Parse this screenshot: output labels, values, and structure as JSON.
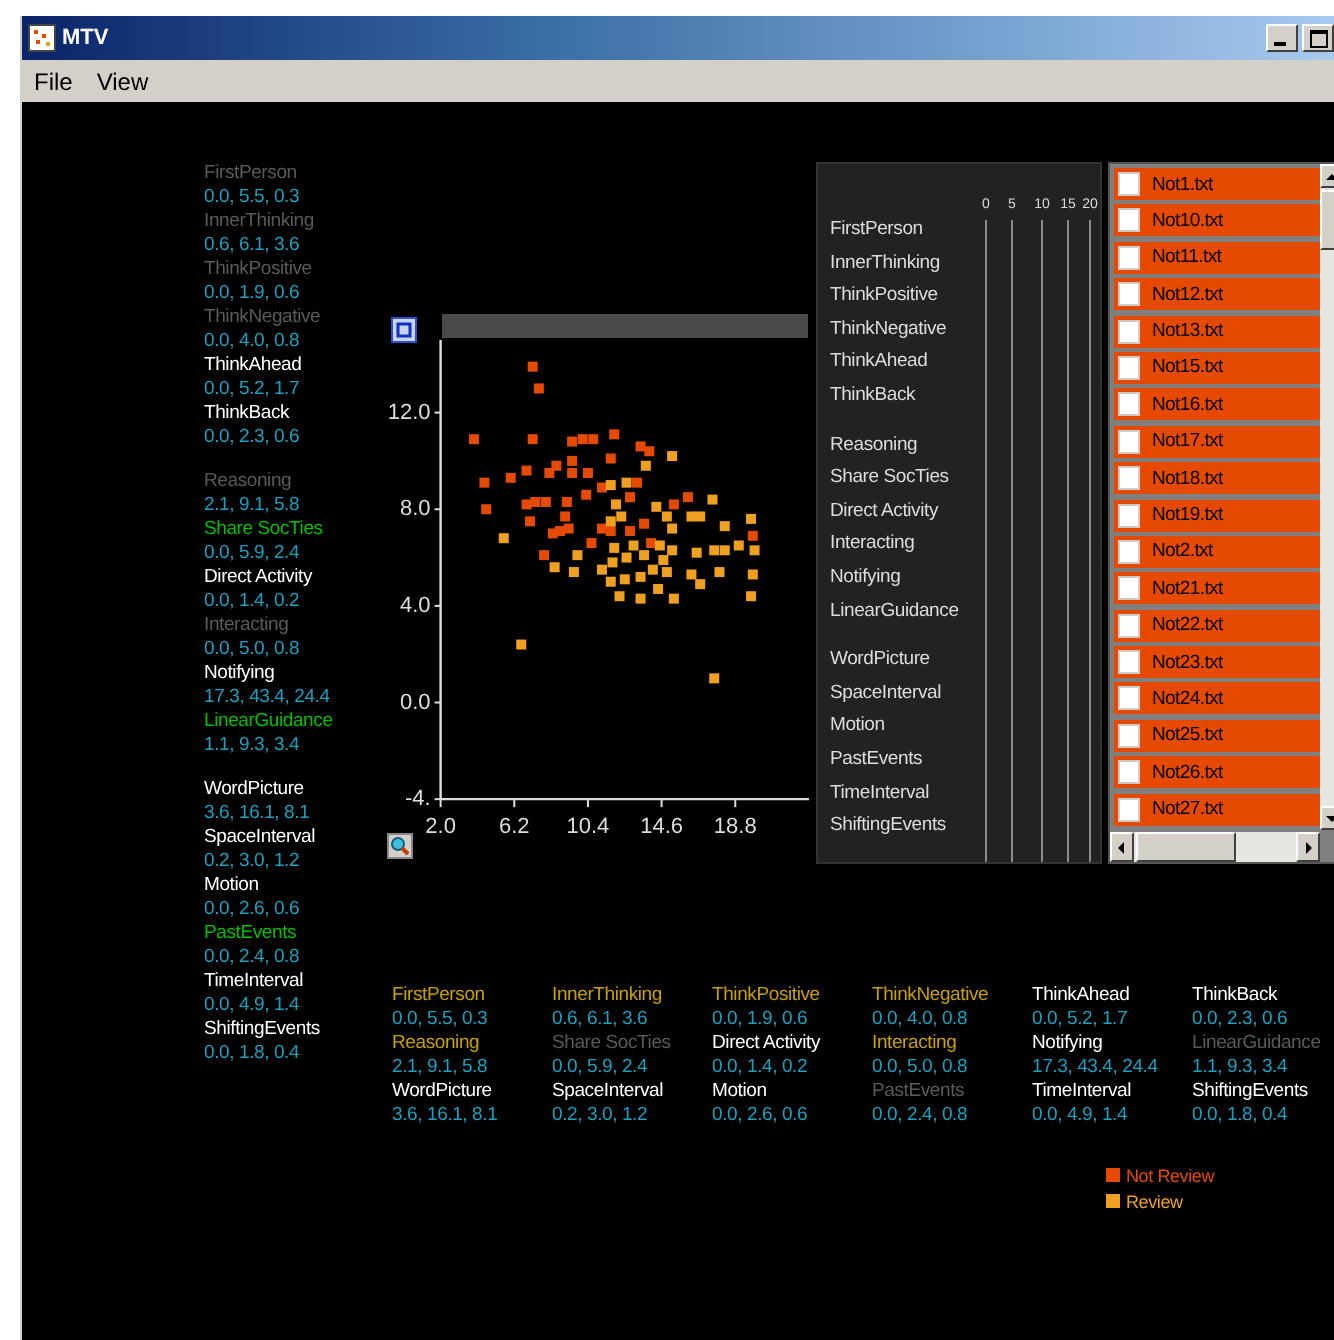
{
  "window": {
    "title": "MTV"
  },
  "menu": [
    "File",
    "View"
  ],
  "feature_groups": [
    {
      "features": [
        {
          "label": "FirstPerson",
          "values": "0.0, 5.5, 0.3",
          "color": "#5a5a5a"
        },
        {
          "label": "InnerThinking",
          "values": "0.6, 6.1, 3.6",
          "color": "#5a5a5a"
        },
        {
          "label": "ThinkPositive",
          "values": "0.0, 1.9, 0.6",
          "color": "#5a5a5a"
        },
        {
          "label": "ThinkNegative",
          "values": "0.0, 4.0, 0.8",
          "color": "#5a5a5a"
        },
        {
          "label": "ThinkAhead",
          "values": "0.0, 5.2, 1.7",
          "color": "#ffffff"
        },
        {
          "label": "ThinkBack",
          "values": "0.0, 2.3, 0.6",
          "color": "#ffffff"
        }
      ]
    },
    {
      "features": [
        {
          "label": "Reasoning",
          "values": "2.1, 9.1, 5.8",
          "color": "#5a5a5a"
        },
        {
          "label": "Share SocTies",
          "values": "0.0, 5.9, 2.4",
          "color": "#00c000"
        },
        {
          "label": "Direct Activity",
          "values": "0.0, 1.4, 0.2",
          "color": "#ffffff"
        },
        {
          "label": "Interacting",
          "values": "0.0, 5.0, 0.8",
          "color": "#5a5a5a"
        },
        {
          "label": "Notifying",
          "values": "17.3, 43.4, 24.4",
          "color": "#ffffff"
        },
        {
          "label": "LinearGuidance",
          "values": "1.1, 9.3, 3.4",
          "color": "#00c000"
        }
      ]
    },
    {
      "features": [
        {
          "label": "WordPicture",
          "values": "3.6, 16.1, 8.1",
          "color": "#ffffff"
        },
        {
          "label": "SpaceInterval",
          "values": "0.2, 3.0, 1.2",
          "color": "#ffffff"
        },
        {
          "label": "Motion",
          "values": "0.0, 2.6, 0.6",
          "color": "#ffffff"
        },
        {
          "label": "PastEvents",
          "values": "0.0, 2.4, 0.8",
          "color": "#00c000"
        },
        {
          "label": "TimeInterval",
          "values": "0.0, 4.9, 1.4",
          "color": "#ffffff"
        },
        {
          "label": "ShiftingEvents",
          "values": "0.0, 1.8, 0.4",
          "color": "#ffffff"
        }
      ]
    }
  ],
  "scatter": {
    "chart_data": {
      "type": "scatter",
      "xlim": [
        2,
        23
      ],
      "ylim": [
        -4,
        15
      ],
      "xticks": [
        {
          "value": 2,
          "label": "2.0"
        },
        {
          "value": 6.2,
          "label": "6.2"
        },
        {
          "value": 10.4,
          "label": "10.4"
        },
        {
          "value": 14.6,
          "label": "14.6"
        },
        {
          "value": 18.8,
          "label": "18.8"
        }
      ],
      "yticks": [
        {
          "value": -4,
          "label": "-4."
        },
        {
          "value": 0,
          "label": "0.0"
        },
        {
          "value": 4,
          "label": "4.0"
        },
        {
          "value": 8,
          "label": "8.0"
        },
        {
          "value": 12,
          "label": "12.0"
        }
      ],
      "series": [
        {
          "name": "Not Review",
          "color": "#e64a00",
          "x": [
            7.25,
            7.6,
            3.9,
            7.25,
            9.5,
            10.1,
            10.7,
            11.9,
            13.4,
            13.9,
            11.7,
            9.5,
            8.6,
            6.9,
            8.2,
            9.5,
            10.4,
            6.0,
            4.5,
            13.2,
            11.2,
            10.3,
            4.6,
            6.9,
            7.4,
            8.0,
            9.2,
            12.8,
            15.3,
            16.1,
            7.1,
            9.1,
            8.4,
            9.3,
            11.2,
            11.7,
            13.6,
            10.6,
            14.0,
            7.9,
            19.8,
            12.8,
            8.8
          ],
          "values": [
            13.9,
            13.0,
            10.9,
            10.9,
            10.8,
            10.9,
            10.9,
            11.1,
            10.6,
            10.4,
            10.1,
            10.0,
            9.8,
            9.6,
            9.5,
            9.5,
            9.5,
            9.3,
            9.1,
            9.1,
            8.9,
            8.6,
            8.0,
            8.2,
            8.3,
            8.3,
            8.3,
            8.5,
            8.2,
            8.5,
            7.5,
            7.7,
            7.0,
            7.2,
            7.2,
            7.1,
            7.4,
            6.6,
            6.6,
            6.1,
            6.9,
            7.1,
            7.1
          ]
        },
        {
          "name": "Review",
          "color": "#f0a020",
          "x": [
            5.6,
            8.5,
            6.6,
            17.6,
            15.2,
            13.7,
            12.6,
            11.7,
            17.5,
            14.3,
            14.9,
            16.3,
            16.8,
            19.7,
            12.0,
            12.3,
            15.2,
            18.2,
            11.9,
            13.0,
            14.5,
            19.0,
            19.9,
            9.8,
            13.6,
            15.2,
            16.6,
            17.6,
            18.2,
            12.6,
            11.8,
            9.6,
            11.2,
            12.5,
            13.4,
            14.1,
            14.9,
            16.3,
            17.9,
            19.8,
            11.7,
            16.8,
            14.4,
            12.2,
            13.4,
            15.3,
            19.7,
            11.7,
            14.7
          ],
          "values": [
            6.8,
            5.6,
            2.4,
            1.0,
            10.2,
            9.8,
            9.1,
            9.0,
            8.4,
            8.1,
            7.7,
            7.7,
            7.7,
            7.6,
            8.2,
            7.7,
            7.2,
            7.3,
            6.4,
            6.5,
            6.5,
            6.5,
            6.3,
            6.1,
            6.1,
            6.3,
            6.2,
            6.3,
            6.3,
            6.0,
            5.8,
            5.4,
            5.5,
            5.1,
            5.2,
            5.5,
            5.4,
            5.3,
            5.4,
            5.3,
            5.0,
            4.9,
            4.7,
            4.4,
            4.3,
            4.3,
            4.4,
            7.5,
            5.9
          ]
        }
      ]
    }
  },
  "profile_panel": {
    "scale_ticks": [
      "0",
      "5",
      "10",
      "15",
      "20"
    ],
    "groups": [
      {
        "labels": [
          "FirstPerson",
          "InnerThinking",
          "ThinkPositive",
          "ThinkNegative",
          "ThinkAhead",
          "ThinkBack"
        ]
      },
      {
        "labels": [
          "Reasoning",
          "Share SocTies",
          "Direct Activity",
          "Interacting",
          "Notifying",
          "LinearGuidance"
        ]
      },
      {
        "labels": [
          "WordPicture",
          "SpaceInterval",
          "Motion",
          "PastEvents",
          "TimeInterval",
          "ShiftingEvents"
        ]
      }
    ]
  },
  "files": [
    {
      "name": "Not1.txt",
      "checked": false
    },
    {
      "name": "Not10.txt",
      "checked": false
    },
    {
      "name": "Not11.txt",
      "checked": false
    },
    {
      "name": "Not12.txt",
      "checked": false
    },
    {
      "name": "Not13.txt",
      "checked": false
    },
    {
      "name": "Not15.txt",
      "checked": false
    },
    {
      "name": "Not16.txt",
      "checked": false
    },
    {
      "name": "Not17.txt",
      "checked": false
    },
    {
      "name": "Not18.txt",
      "checked": false
    },
    {
      "name": "Not19.txt",
      "checked": false
    },
    {
      "name": "Not2.txt",
      "checked": false
    },
    {
      "name": "Not21.txt",
      "checked": false
    },
    {
      "name": "Not22.txt",
      "checked": false
    },
    {
      "name": "Not23.txt",
      "checked": false
    },
    {
      "name": "Not24.txt",
      "checked": false
    },
    {
      "name": "Not25.txt",
      "checked": false
    },
    {
      "name": "Not26.txt",
      "checked": false
    },
    {
      "name": "Not27.txt",
      "checked": false
    }
  ],
  "summary": [
    {
      "label": "FirstPerson",
      "values": "0.0, 5.5, 0.3",
      "color": "#c8a000"
    },
    {
      "label": "InnerThinking",
      "values": "0.6, 6.1, 3.6",
      "color": "#c8a000"
    },
    {
      "label": "ThinkPositive",
      "values": "0.0, 1.9, 0.6",
      "color": "#c8a000"
    },
    {
      "label": "ThinkNegative",
      "values": "0.0, 4.0, 0.8",
      "color": "#c8a000"
    },
    {
      "label": "ThinkAhead",
      "values": "0.0, 5.2, 1.7",
      "color": "#ffffff"
    },
    {
      "label": "ThinkBack",
      "values": "0.0, 2.3, 0.6",
      "color": "#ffffff"
    },
    {
      "label": "Reasoning",
      "values": "2.1, 9.1, 5.8",
      "color": "#c8a000"
    },
    {
      "label": "Share SocTies",
      "values": "0.0, 5.9, 2.4",
      "color": "#5a5a5a"
    },
    {
      "label": "Direct Activity",
      "values": "0.0, 1.4, 0.2",
      "color": "#ffffff"
    },
    {
      "label": "Interacting",
      "values": "0.0, 5.0, 0.8",
      "color": "#c8a000"
    },
    {
      "label": "Notifying",
      "values": "17.3, 43.4, 24.4",
      "color": "#ffffff"
    },
    {
      "label": "LinearGuidance",
      "values": "1.1, 9.3, 3.4",
      "color": "#5a5a5a"
    },
    {
      "label": "WordPicture",
      "values": "3.6, 16.1, 8.1",
      "color": "#ffffff"
    },
    {
      "label": "SpaceInterval",
      "values": "0.2, 3.0, 1.2",
      "color": "#ffffff"
    },
    {
      "label": "Motion",
      "values": "0.0, 2.6, 0.6",
      "color": "#ffffff"
    },
    {
      "label": "PastEvents",
      "values": "0.0, 2.4, 0.8",
      "color": "#5a5a5a"
    },
    {
      "label": "TimeInterval",
      "values": "0.0, 4.9, 1.4",
      "color": "#ffffff"
    },
    {
      "label": "ShiftingEvents",
      "values": "0.0, 1.8, 0.4",
      "color": "#ffffff"
    }
  ]
}
